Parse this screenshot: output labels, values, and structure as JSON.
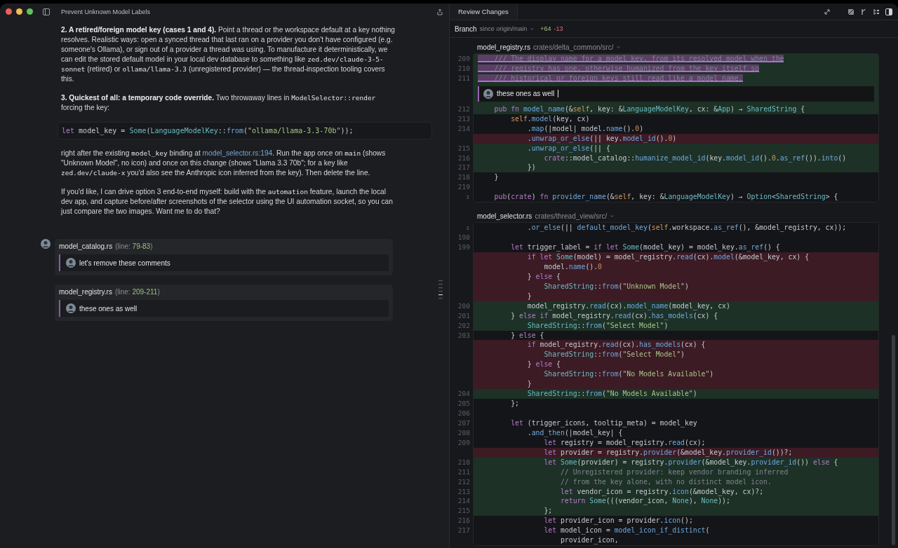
{
  "window": {
    "title": "Prevent Unknown Model Labels"
  },
  "conversation": {
    "blocks": [
      {
        "kind": "paragraph",
        "segments": [
          {
            "kind": "bold",
            "text": "2. A retired/foreign model key (cases 1 and 4)."
          },
          {
            "kind": "text",
            "text": " Point a thread or the workspace default at a key nothing resolves. Realistic ways: open a synced thread that last ran on a provider you don't have configured (e.g. someone's Ollama), or sign out of a provider a thread was using. To manufacture it deterministically, we can edit the stored default model in your local dev database to something like "
          },
          {
            "kind": "code",
            "text": "zed.dev/claude-3-5-sonnet"
          },
          {
            "kind": "text",
            "text": " (retired) or "
          },
          {
            "kind": "code",
            "text": "ollama/llama-3.3"
          },
          {
            "kind": "text",
            "text": " (unregistered provider) — the thread-inspection tooling covers this."
          }
        ]
      },
      {
        "kind": "paragraph",
        "segments": [
          {
            "kind": "bold",
            "text": "3. Quickest of all: a temporary code override."
          },
          {
            "kind": "text",
            "text": " Two throwaway lines in "
          },
          {
            "kind": "code",
            "text": "ModelSelector::render"
          },
          {
            "kind": "text",
            "text": " forcing the key:"
          }
        ]
      },
      {
        "kind": "codeblock",
        "text": "let model_key = Some(LanguageModelKey::from(\"ollama/llama-3.3-70b\"));"
      },
      {
        "kind": "paragraph",
        "segments": [
          {
            "kind": "text",
            "text": "right after the existing "
          },
          {
            "kind": "code",
            "text": "model_key"
          },
          {
            "kind": "text",
            "text": " binding at "
          },
          {
            "kind": "link",
            "text": "model_selector.rs:194"
          },
          {
            "kind": "text",
            "text": ". Run the app once on "
          },
          {
            "kind": "code",
            "text": "main"
          },
          {
            "kind": "text",
            "text": " (shows \"Unknown Model\", no icon) and once on this change (shows \"Llama 3.3 70b\"; for a key like "
          },
          {
            "kind": "code",
            "text": "zed.dev/claude-x"
          },
          {
            "kind": "text",
            "text": " you'd also see the Anthropic icon inferred from the key). Then delete the line."
          }
        ]
      },
      {
        "kind": "paragraph",
        "segments": [
          {
            "kind": "text",
            "text": "If you'd like, I can drive option 3 end-to-end myself: build with the "
          },
          {
            "kind": "code",
            "text": "automation"
          },
          {
            "kind": "text",
            "text": " feature, launch the local dev app, and capture before/after screenshots of the selector using the UI automation socket, so you can just compare the two images. Want me to do that?"
          }
        ]
      }
    ],
    "review_comments": [
      {
        "file": "model_catalog.rs",
        "line_label": "(line: ",
        "lines": "79-83",
        "close": ")",
        "comment": "let's remove these comments",
        "show_author": true
      },
      {
        "file": "model_registry.rs",
        "line_label": "(line: ",
        "lines": "209-211",
        "close": ")",
        "comment": "these ones as well",
        "show_author": false
      }
    ]
  },
  "review": {
    "tab": "Review Changes",
    "branch_label": "Branch",
    "since": "since origin/main",
    "added": "+64",
    "removed": "-13",
    "files": [
      {
        "name": "model_registry.rs",
        "path": "crates/delta_common/src/",
        "lines": [
          {
            "kind": "added",
            "num": "209",
            "text": "    /// The display name for a model key, from its resolved model when the",
            "highlighted": true
          },
          {
            "kind": "added",
            "num": "210",
            "text": "    /// registry has one, otherwise humanized from the key itself so",
            "highlighted": true
          },
          {
            "kind": "added",
            "num": "211",
            "text": "    /// historical or foreign keys still read like a model name.",
            "highlighted": true
          },
          {
            "kind": "comment",
            "text": "these ones as well"
          },
          {
            "kind": "added",
            "num": "212",
            "text": "    pub fn model_name(&self, key: &LanguageModelKey, cx: &App) → SharedString {",
            "highlighted": false
          },
          {
            "kind": "context",
            "num": "213",
            "text": "        self.model(key, cx)",
            "highlighted": false
          },
          {
            "kind": "context",
            "num": "214",
            "text": "            .map(|model| model.name().0)",
            "highlighted": false
          },
          {
            "kind": "removed",
            "text": "            .unwrap_or_else(|| key.model_id().0)",
            "highlighted": false
          },
          {
            "kind": "added",
            "num": "215",
            "text": "            .unwrap_or_else(|| {",
            "highlighted": false
          },
          {
            "kind": "added",
            "num": "216",
            "text": "                crate::model_catalog::humanize_model_id(key.model_id().0.as_ref()).into()",
            "highlighted": false
          },
          {
            "kind": "added",
            "num": "217",
            "text": "            })",
            "highlighted": false
          },
          {
            "kind": "context",
            "num": "218",
            "text": "    }",
            "highlighted": false
          },
          {
            "kind": "context",
            "num": "219",
            "highlighted": false
          },
          {
            "kind": "context",
            "num": "↧",
            "text": "    pub(crate) fn provider_name(&self, key: &LanguageModelKey) → Option<SharedString> {",
            "highlighted": false
          }
        ]
      },
      {
        "name": "model_selector.rs",
        "path": "crates/thread_view/src/",
        "lines": [
          {
            "kind": "context",
            "num": "↥",
            "text": "            .or_else(|| default_model_key(self.workspace.as_ref(), &model_registry, cx));"
          },
          {
            "kind": "context",
            "num": "198"
          },
          {
            "kind": "context",
            "num": "199",
            "text": "        let trigger_label = if let Some(model_key) = model_key.as_ref() {"
          },
          {
            "kind": "removed",
            "text": "            if let Some(model) = model_registry.read(cx).model(&model_key, cx) {"
          },
          {
            "kind": "removed",
            "text": "                model.name().0"
          },
          {
            "kind": "removed",
            "text": "            } else {"
          },
          {
            "kind": "removed",
            "text": "                SharedString::from(\"Unknown Model\")"
          },
          {
            "kind": "removed",
            "text": "            }"
          },
          {
            "kind": "added",
            "num": "200",
            "text": "            model_registry.read(cx).model_name(model_key, cx)"
          },
          {
            "kind": "added",
            "num": "201",
            "text": "        } else if model_registry.read(cx).has_models(cx) {"
          },
          {
            "kind": "added",
            "num": "202",
            "text": "            SharedString::from(\"Select Model\")"
          },
          {
            "kind": "context",
            "num": "203",
            "text": "        } else {"
          },
          {
            "kind": "removed",
            "text": "            if model_registry.read(cx).has_models(cx) {"
          },
          {
            "kind": "removed",
            "text": "                SharedString::from(\"Select Model\")"
          },
          {
            "kind": "removed",
            "text": "            } else {"
          },
          {
            "kind": "removed",
            "text": "                SharedString::from(\"No Models Available\")"
          },
          {
            "kind": "removed",
            "text": "            }"
          },
          {
            "kind": "added",
            "num": "204",
            "text": "            SharedString::from(\"No Models Available\")"
          },
          {
            "kind": "context",
            "num": "205",
            "text": "        };"
          },
          {
            "kind": "context",
            "num": "206"
          },
          {
            "kind": "context",
            "num": "207",
            "text": "        let (trigger_icons, tooltip_meta) = model_key"
          },
          {
            "kind": "context",
            "num": "208",
            "text": "            .and_then(|model_key| {"
          },
          {
            "kind": "context",
            "num": "209",
            "text": "                let registry = model_registry.read(cx);"
          },
          {
            "kind": "removed",
            "text": "                let provider = registry.provider(&model_key.provider_id())?;"
          },
          {
            "kind": "added",
            "num": "210",
            "text": "                let Some(provider) = registry.provider(&model_key.provider_id()) else {"
          },
          {
            "kind": "added",
            "num": "211",
            "text": "                    // Unregistered provider: keep vendor branding inferred"
          },
          {
            "kind": "added",
            "num": "212",
            "text": "                    // from the key alone, with no distinct model icon."
          },
          {
            "kind": "added",
            "num": "213",
            "text": "                    let vendor_icon = registry.icon(&model_key, cx)?;"
          },
          {
            "kind": "added",
            "num": "214",
            "text": "                    return Some(((vendor_icon, None), None));"
          },
          {
            "kind": "added",
            "num": "215",
            "text": "                };"
          },
          {
            "kind": "context",
            "num": "216",
            "text": "                let provider_icon = provider.icon();"
          },
          {
            "kind": "context",
            "num": "217",
            "text": "                let model_icon = model_icon_if_distinct("
          },
          {
            "kind": "context",
            "text": "                    provider_icon,"
          }
        ]
      }
    ]
  }
}
